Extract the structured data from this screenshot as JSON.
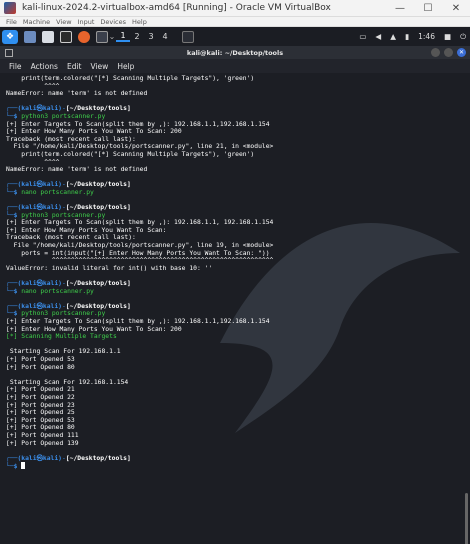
{
  "vbox": {
    "title": "kali-linux-2024.2-virtualbox-amd64 [Running] - Oracle VM VirtualBox",
    "menu": [
      "File",
      "Machine",
      "View",
      "Input",
      "Devices",
      "Help"
    ],
    "btn_min": "—",
    "btn_max": "☐",
    "btn_close": "✕"
  },
  "panel": {
    "workspaces": [
      "1",
      "2",
      "3",
      "4"
    ],
    "clock": "1:46"
  },
  "terminal": {
    "window_title": "kali@kali: ~/Desktop/tools",
    "menu": [
      "File",
      "Actions",
      "Edit",
      "View",
      "Help"
    ],
    "prompt_user": "(kali㉿kali)",
    "prompt_path": "[~/Desktop/tools]",
    "prompt_sym": "$",
    "lines": {
      "l0": "    print(term.colored(\"[*] Scanning Multiple Targets\"), 'green')",
      "l1": "          ^^^^",
      "l2": "NameError: name 'term' is not defined",
      "c1": "python3 portscanner.py",
      "l3": "[+] Enter Targets To Scan(split them by ,): 192.168.1.1,192.168.1.154",
      "l4": "[+] Enter How Many Ports You Want To Scan: 200",
      "l5": "Traceback (most recent call last):",
      "l6": "  File \"/home/kali/Desktop/tools/portscanner.py\", line 21, in <module>",
      "l7": "    print(term.colored(\"[*] Scanning Multiple Targets\"), 'green')",
      "l8": "          ^^^^",
      "l9": "NameError: name 'term' is not defined",
      "c2": "nano portscanner.py",
      "c3": "python3 portscanner.py",
      "l10": "[+] Enter Targets To Scan(split them by ,): 192.168.1.1, 192.168.1.154",
      "l11": "[+] Enter How Many Ports You Want To Scan:",
      "l12": "Traceback (most recent call last):",
      "l13": "  File \"/home/kali/Desktop/tools/portscanner.py\", line 19, in <module>",
      "l14": "    ports = int(input(\"[+] Enter How Many Ports You Want To Scan: \"))",
      "l15": "            ^^^^^^^^^^^^^^^^^^^^^^^^^^^^^^^^^^^^^^^^^^^^^^^^^^^^^^^^^^",
      "l16": "ValueError: invalid literal for int() with base 10: ''",
      "c4": "nano portscanner.py",
      "c5": "python3 portscanner.py",
      "l17": "[+] Enter Targets To Scan(split them by ,): 192.168.1.1,192.168.1.154",
      "l18": "[+] Enter How Many Ports You Want To Scan: 200",
      "l19": "[*] Scanning Multiple Targets",
      "s1": " Starting Scan For 192.168.1.1",
      "s2": "[+] Port Opened 53",
      "s3": "[+] Port Opened 80",
      "s4": " Starting Scan For 192.168.1.154",
      "p1": "[+] Port Opened 21",
      "p2": "[+] Port Opened 22",
      "p3": "[+] Port Opened 23",
      "p4": "[+] Port Opened 25",
      "p5": "[+] Port Opened 53",
      "p6": "[+] Port Opened 80",
      "p7": "[+] Port Opened 111",
      "p8": "[+] Port Opened 139"
    }
  }
}
